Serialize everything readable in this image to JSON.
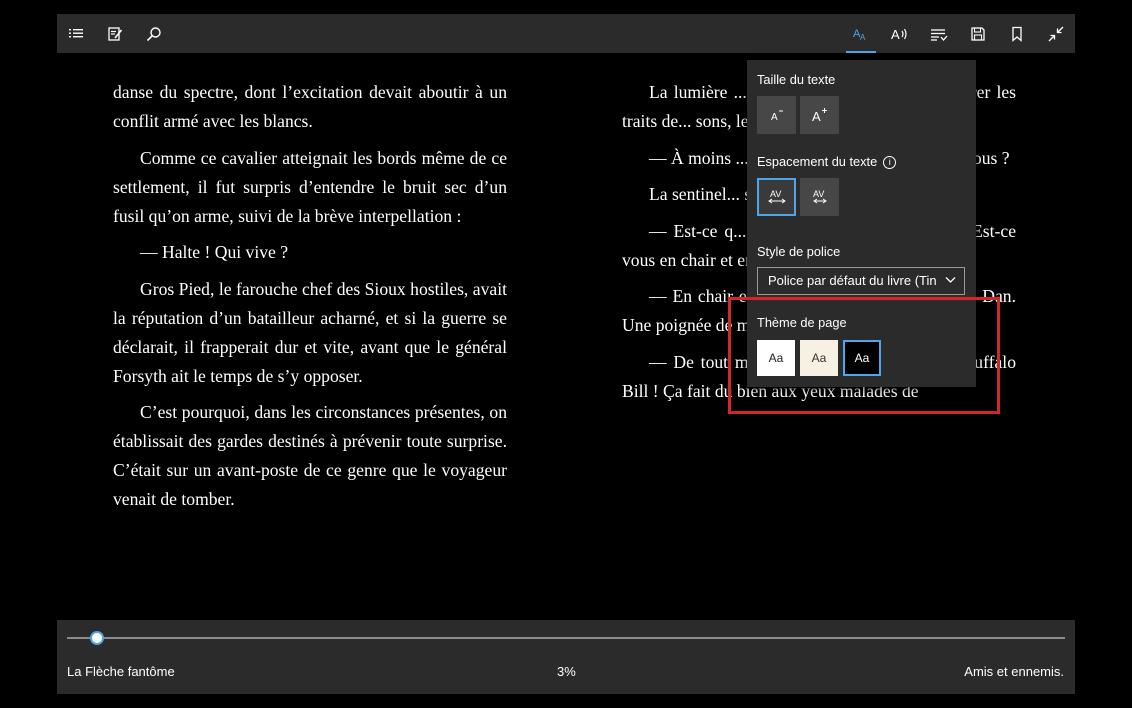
{
  "toolbar": {
    "icons": [
      "table-of-contents-icon",
      "notes-icon",
      "search-icon",
      "text-options-icon",
      "read-aloud-icon",
      "learning-tools-icon",
      "save-icon",
      "bookmark-icon",
      "exit-fullscreen-icon"
    ],
    "accent_color": "#4ea6ea"
  },
  "left_page": {
    "paragraphs": [
      "danse du spectre, dont l’excitation devait aboutir à un conflit armé avec les blancs.",
      "Comme ce cavalier atteignait les bords même de ce settlement, il fut surpris d’entendre le bruit sec d’un fusil qu’on arme, suivi de la brève interpellation :",
      "— Halte ! Qui vive ?",
      "Gros Pied, le farouche chef des Sioux hostiles, avait la réputation d’un batailleur acharné, et si la guerre se déclarait, il frapperait dur et vite, avant que le général Forsyth ait le temps de s’y opposer.",
      "C’est pourquoi, dans les circonstances présentes, on établissait des gardes destinés à prévenir toute surprise. C’était sur un avant-poste de ce genre que le voyageur venait de tomber."
    ]
  },
  "right_page": {
    "paragraphs": [
      "La lumière ... pâle ciel d’hiver ; ma... mon-trer les traits de... sons, le fusil à la main",
      "— À moins ... t, j’ai déjà vu cette fig... allez-vous ?",
      "La sentinel... sur la jambe du caval...",
      "— Est-ce q... bre ? William Cody, parlez ! Est-ce vous en chair et en os ?",
      "— En chair et en os, vrai comme un sermon, Dan. Une poignée de main !",
      "— De tout mon cœur, Dieu vous bénisse, Buffalo Bill ! Ça fait du bien aux yeux malades de"
    ]
  },
  "panel": {
    "text_size_label": "Taille du texte",
    "text_spacing_label": "Espacement du texte",
    "info_glyph": "i",
    "font_style_label": "Style de police",
    "font_select_value": "Police par défaut du livre (Tin",
    "page_theme_label": "Thème de page",
    "theme_sample": "Aa",
    "selected_theme": "black",
    "highlight_color": "#d0272c"
  },
  "footer": {
    "book_title": "La Flèche fantôme",
    "progress_label": "3%",
    "progress_fraction": 0.03,
    "chapter_title": "Amis et ennemis."
  }
}
